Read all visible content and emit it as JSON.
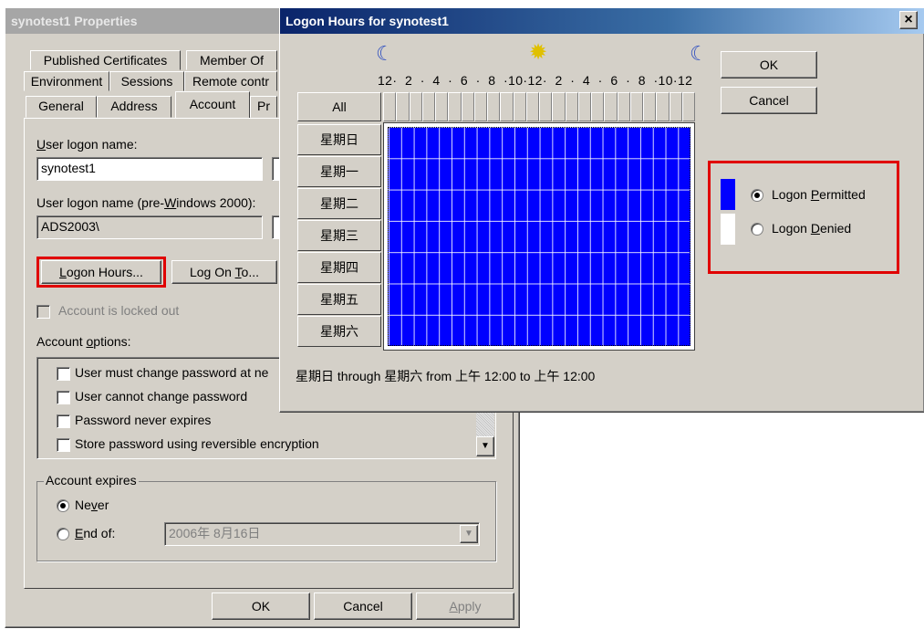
{
  "props": {
    "title": "synotest1 Properties",
    "tabs_row1": [
      "Published Certificates",
      "Member Of"
    ],
    "tabs_row2": [
      "Environment",
      "Sessions",
      "Remote contr"
    ],
    "tabs_row3": [
      "General",
      "Address",
      "Account",
      "Pr"
    ],
    "user_logon_label": "User logon name:",
    "user_logon_value": "synotest1",
    "pre2000_label": "User logon name (pre-Windows 2000):",
    "pre2000_value": "ADS2003\\",
    "logon_hours_btn": "Logon Hours...",
    "log_on_to_btn": "Log On To...",
    "locked_out": "Account is locked out",
    "options_label": "Account options:",
    "options": [
      "User must change password at ne",
      "User cannot change password",
      "Password never expires",
      "Store password using reversible encryption"
    ],
    "expires_label": "Account expires",
    "never": "Never",
    "end_of": "End of:",
    "end_date": "2006年  8月16日",
    "ok": "OK",
    "cancel": "Cancel",
    "apply": "Apply"
  },
  "logon": {
    "title": "Logon Hours for synotest1",
    "close": "×",
    "hour_scale": "12·  2  ·  4  ·  6  ·  8  ·10·12·  2  ·  4  ·  6  ·  8  ·10·12",
    "all": "All",
    "days": [
      "星期日",
      "星期一",
      "星期二",
      "星期三",
      "星期四",
      "星期五",
      "星期六"
    ],
    "ok": "OK",
    "cancel": "Cancel",
    "permitted": "Logon Permitted",
    "denied": "Logon Denied",
    "status": "星期日 through 星期六 from 上午 12:00 to 上午 12:00",
    "permitted_color": "#0000ff",
    "denied_color": "#ffffff",
    "highlight_color": "#e00000"
  }
}
